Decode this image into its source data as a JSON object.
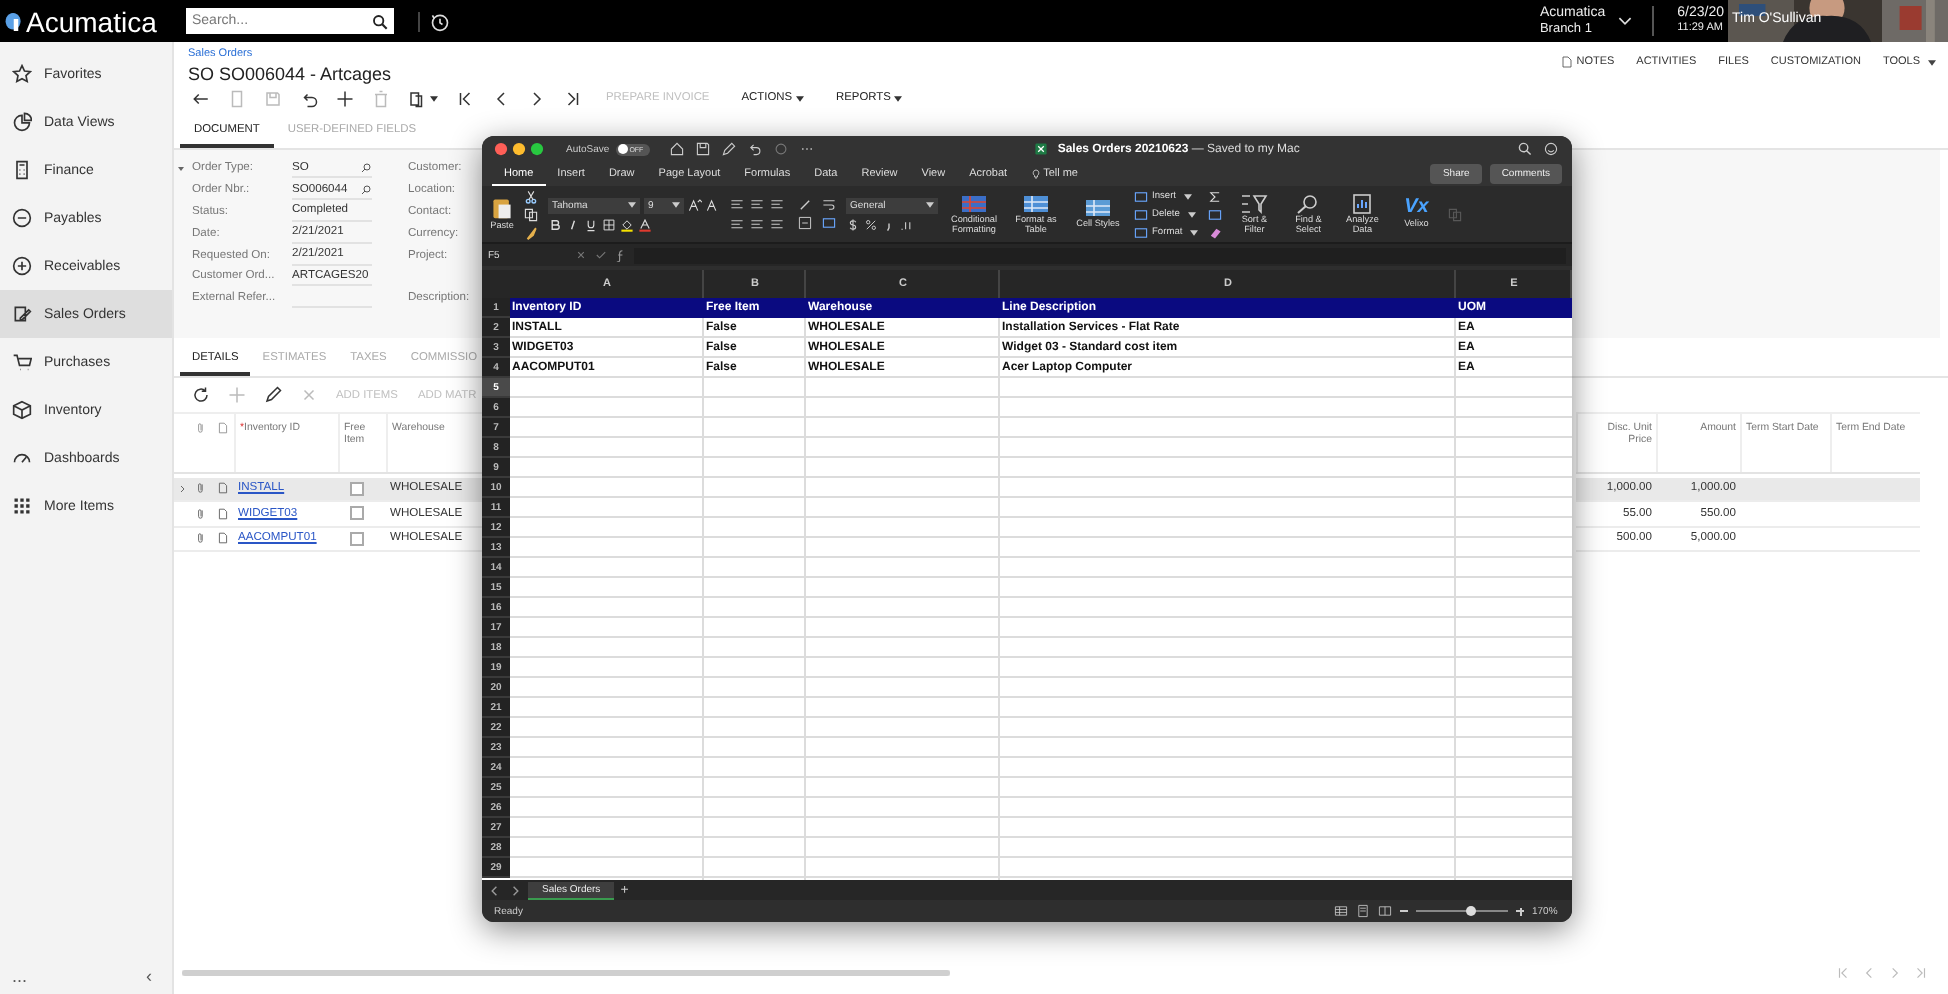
{
  "top_bar": {
    "logo": "Acumatica",
    "search": {
      "placeholder": "Search..."
    },
    "company": "Acumatica",
    "branch": "Branch 1",
    "date": "6/23/20",
    "time": "11:29 AM",
    "video": {
      "kind": "picture",
      "caption": "Tim O'Sullivan"
    }
  },
  "sidebar": {
    "items": [
      {
        "label": "Favorites",
        "kind": "star",
        "selected": false
      },
      {
        "label": "Data Views",
        "kind": "pie",
        "selected": false
      },
      {
        "label": "Finance",
        "kind": "calc",
        "selected": false
      },
      {
        "label": "Payables",
        "kind": "minus",
        "selected": false
      },
      {
        "label": "Receivables",
        "kind": "plus",
        "selected": false
      },
      {
        "label": "Sales Orders",
        "kind": "orders",
        "selected": true
      },
      {
        "label": "Purchases",
        "kind": "cart",
        "selected": false
      },
      {
        "label": "Inventory",
        "kind": "box",
        "selected": false
      },
      {
        "label": "Dashboards",
        "kind": "gauge",
        "selected": false
      },
      {
        "label": "More Items",
        "kind": "grid",
        "selected": false
      }
    ],
    "more": "...",
    "collapse": "‹"
  },
  "page": {
    "breadcrumb": "Sales Orders",
    "title": "SO SO006044 - Artcages",
    "toolbar": [
      {
        "kind": "back",
        "disabled": false
      },
      {
        "kind": "cancel",
        "disabled": true
      },
      {
        "kind": "save",
        "disabled": true
      },
      {
        "kind": "undo",
        "disabled": false
      },
      {
        "kind": "add",
        "disabled": false
      },
      {
        "kind": "delete",
        "disabled": true
      },
      {
        "kind": "copy",
        "disabled": false
      },
      {
        "kind": "first",
        "disabled": false
      },
      {
        "kind": "prev",
        "disabled": false
      },
      {
        "kind": "next",
        "disabled": false
      },
      {
        "kind": "last",
        "disabled": false
      }
    ],
    "actions": [
      {
        "label": "PREPARE INVOICE",
        "disabled": true,
        "menu": false
      },
      {
        "label": "ACTIONS",
        "disabled": false,
        "menu": true
      },
      {
        "label": "REPORTS",
        "disabled": false,
        "menu": true
      }
    ],
    "links": [
      {
        "label": "NOTES",
        "kind": "notes"
      },
      {
        "label": "ACTIVITIES",
        "kind": "plain"
      },
      {
        "label": "FILES",
        "kind": "plain"
      },
      {
        "label": "CUSTOMIZATION",
        "kind": "plain"
      },
      {
        "label": "TOOLS",
        "kind": "menu"
      }
    ]
  },
  "doc_tabs": [
    {
      "label": "DOCUMENT",
      "selected": true
    },
    {
      "label": "USER-DEFINED FIELDS",
      "selected": false
    }
  ],
  "form": {
    "fields": [
      {
        "label": "Order Type:",
        "value": "SO",
        "kind": "lookup",
        "right_label": "Customer:"
      },
      {
        "label": "Order Nbr.:",
        "value": "SO006044",
        "kind": "lookup",
        "right_label": "Location:"
      },
      {
        "label": "Status:",
        "value": "Completed",
        "kind": "text",
        "right_label": "Contact:"
      },
      {
        "label": "Date:",
        "value": "2/21/2021",
        "kind": "text",
        "right_label": "Currency:"
      },
      {
        "label": "Requested On:",
        "value": "2/21/2021",
        "kind": "text",
        "right_label": "Project:"
      },
      {
        "label": "Customer Ord...",
        "value": "ARTCAGES20",
        "kind": "text"
      },
      {
        "label": "External Refer...",
        "kind": "text",
        "right_label": "Description:"
      }
    ]
  },
  "details": {
    "tabs": [
      {
        "label": "DETAILS",
        "selected": true
      },
      {
        "label": "ESTIMATES",
        "selected": false
      },
      {
        "label": "TAXES",
        "selected": false
      },
      {
        "label": "COMMISSIO",
        "selected": false
      }
    ],
    "toolbar": [
      {
        "kind": "refresh",
        "disabled": false
      },
      {
        "kind": "add",
        "disabled": true
      },
      {
        "kind": "edit",
        "disabled": false
      },
      {
        "kind": "close",
        "disabled": true
      }
    ],
    "actions": [
      {
        "label": "ADD ITEMS",
        "disabled": true
      },
      {
        "label": "ADD MATR",
        "disabled": true
      }
    ],
    "columns": [
      {
        "label": "Inventory ID",
        "required_mark": "*"
      },
      {
        "label": "Free Item"
      },
      {
        "label": "Warehouse"
      }
    ],
    "right_columns": [
      "Disc. Unit Price",
      "Amount",
      "Term Start Date",
      "Term End Date"
    ],
    "rows": [
      {
        "inventory_id": "INSTALL",
        "free_item": false,
        "warehouse": "WHOLESALE",
        "disc_unit_price": "1,000.00",
        "amount": "1,000.00",
        "selected": true
      },
      {
        "inventory_id": "WIDGET03",
        "free_item": false,
        "warehouse": "WHOLESALE",
        "disc_unit_price": "55.00",
        "amount": "550.00",
        "selected": false
      },
      {
        "inventory_id": "AACOMPUT01",
        "free_item": false,
        "warehouse": "WHOLESALE",
        "disc_unit_price": "500.00",
        "amount": "5,000.00",
        "selected": false
      }
    ]
  },
  "excel": {
    "title": "Sales Orders 20210623",
    "save_status": "— Saved to my Mac",
    "autosave": {
      "label": "AutoSave",
      "on": false,
      "state": "OFF"
    },
    "tabs": [
      {
        "label": "Home",
        "selected": true
      },
      {
        "label": "Insert",
        "selected": false
      },
      {
        "label": "Draw",
        "selected": false
      },
      {
        "label": "Page Layout",
        "selected": false
      },
      {
        "label": "Formulas",
        "selected": false
      },
      {
        "label": "Data",
        "selected": false
      },
      {
        "label": "Review",
        "selected": false
      },
      {
        "label": "View",
        "selected": false
      },
      {
        "label": "Acrobat",
        "selected": false
      }
    ],
    "tell_me": "Tell me",
    "share": "Share",
    "comments": "Comments",
    "ribbon": {
      "paste": "Paste",
      "font": "Tahoma",
      "size": "9",
      "number_format": "General",
      "style_buttons": [
        "Conditional Formatting",
        "Format as Table",
        "Cell Styles"
      ],
      "cells_menu": [
        "Insert",
        "Delete",
        "Format"
      ],
      "tools": [
        "Sort & Filter",
        "Find & Select",
        "Analyze Data"
      ],
      "addin_logo": "Vx",
      "addin": "Velixo"
    },
    "name_box": "F5",
    "columns": [
      "A",
      "B",
      "C",
      "D",
      "E"
    ],
    "rows": [
      {
        "label": "1",
        "selected": false,
        "kind": "header",
        "cells": [
          "Inventory ID",
          "Free Item",
          "Warehouse",
          "Line Description",
          "UOM"
        ]
      },
      {
        "label": "2",
        "selected": false,
        "kind": "data",
        "cells": [
          "INSTALL",
          "False",
          "WHOLESALE",
          "Installation Services - Flat Rate",
          "EA"
        ]
      },
      {
        "label": "3",
        "selected": false,
        "kind": "data",
        "cells": [
          "WIDGET03",
          "False",
          "WHOLESALE",
          "Widget 03 - Standard cost item",
          "EA"
        ]
      },
      {
        "label": "4",
        "selected": false,
        "kind": "data",
        "cells": [
          "AACOMPUT01",
          "False",
          "WHOLESALE",
          "Acer Laptop Computer",
          "EA"
        ]
      },
      {
        "label": "5",
        "selected": true,
        "kind": "data"
      },
      {
        "label": "6",
        "selected": false,
        "kind": "data"
      },
      {
        "label": "7",
        "selected": false,
        "kind": "data"
      },
      {
        "label": "8",
        "selected": false,
        "kind": "data"
      },
      {
        "label": "9",
        "selected": false,
        "kind": "data"
      },
      {
        "label": "10",
        "selected": false,
        "kind": "data"
      },
      {
        "label": "11",
        "selected": false,
        "kind": "data"
      },
      {
        "label": "12",
        "selected": false,
        "kind": "data"
      },
      {
        "label": "13",
        "selected": false,
        "kind": "data"
      },
      {
        "label": "14",
        "selected": false,
        "kind": "data"
      },
      {
        "label": "15",
        "selected": false,
        "kind": "data"
      },
      {
        "label": "16",
        "selected": false,
        "kind": "data"
      },
      {
        "label": "17",
        "selected": false,
        "kind": "data"
      },
      {
        "label": "18",
        "selected": false,
        "kind": "data"
      },
      {
        "label": "19",
        "selected": false,
        "kind": "data"
      },
      {
        "label": "20",
        "selected": false,
        "kind": "data"
      },
      {
        "label": "21",
        "selected": false,
        "kind": "data"
      },
      {
        "label": "22",
        "selected": false,
        "kind": "data"
      },
      {
        "label": "23",
        "selected": false,
        "kind": "data"
      },
      {
        "label": "24",
        "selected": false,
        "kind": "data"
      },
      {
        "label": "25",
        "selected": false,
        "kind": "data"
      },
      {
        "label": "26",
        "selected": false,
        "kind": "data"
      },
      {
        "label": "27",
        "selected": false,
        "kind": "data"
      },
      {
        "label": "28",
        "selected": false,
        "kind": "data"
      },
      {
        "label": "29",
        "selected": false,
        "kind": "data"
      }
    ],
    "sheet_tabs": [
      {
        "label": "Sales Orders",
        "selected": true
      }
    ],
    "add_sheet": "+",
    "status": "Ready",
    "zoom": {
      "level": 0.6,
      "reading": "170%"
    }
  }
}
